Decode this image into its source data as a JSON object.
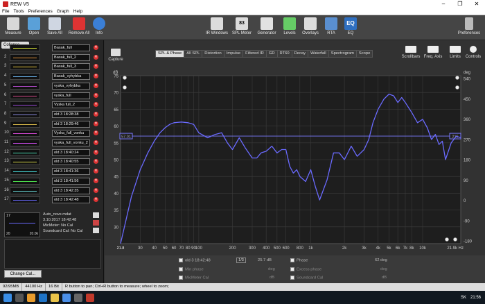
{
  "app": {
    "title": "REW V5",
    "window_controls": [
      "–",
      "❐",
      "✕"
    ]
  },
  "menu": [
    "File",
    "Tools",
    "Preferences",
    "Graph",
    "Help"
  ],
  "toolbar": {
    "left": [
      {
        "label": "Measure",
        "icon": "microphone-icon",
        "color": "#d8d8d8"
      },
      {
        "label": "Open",
        "icon": "folder-icon",
        "color": "#5aa0d8"
      },
      {
        "label": "Save All",
        "icon": "floppy-icon",
        "color": "#cfd6e2"
      },
      {
        "label": "Remove All",
        "icon": "remove-x-icon",
        "color": "#d33"
      },
      {
        "label": "Info",
        "icon": "info-icon",
        "color": "#3b7fd6"
      }
    ],
    "center": [
      {
        "label": "IR Windows",
        "icon": "ir-windows-icon",
        "color": "#dcdcdc"
      },
      {
        "label": "SPL Meter",
        "icon": "spl-meter-icon",
        "color": "#dcdcdc",
        "text": "SPL\n83"
      },
      {
        "label": "Generator",
        "icon": "generator-icon",
        "color": "#e2e2e2"
      },
      {
        "label": "Levels",
        "icon": "levels-icon",
        "color": "#6c6"
      },
      {
        "label": "Overlays",
        "icon": "overlays-icon",
        "color": "#dcdcdc"
      },
      {
        "label": "RTA",
        "icon": "rta-icon",
        "color": "#5a8fd0"
      },
      {
        "label": "EQ",
        "icon": "eq-icon",
        "color": "#2f6fc0",
        "text": "EQ"
      }
    ],
    "right": {
      "label": "Preferences",
      "icon": "wrench-icon"
    }
  },
  "left_panel": {
    "collapse": "Collapse",
    "measurements": [
      {
        "num": "1",
        "name": "Basak_full",
        "color": "#d9e63a"
      },
      {
        "num": "2",
        "name": "Basak_full_2",
        "color": "#e0903a"
      },
      {
        "num": "3",
        "name": "Basak_full_3",
        "color": "#e2c23a"
      },
      {
        "num": "4",
        "name": "Basak_vyhybka",
        "color": "#6ab0e8"
      },
      {
        "num": "5",
        "name": "vyska_vyhybka",
        "color": "#b04ac8"
      },
      {
        "num": "6",
        "name": "vyska_full",
        "color": "#d84a8a"
      },
      {
        "num": "7",
        "name": "Vyska full_2",
        "color": "#9a4ad8"
      },
      {
        "num": "8",
        "name": "old 3 18:28:38",
        "color": "#8a8ae0"
      },
      {
        "num": "9",
        "name": "old 3 18:29:46",
        "color": "#d8b84a"
      },
      {
        "num": "10",
        "name": "Vyska_full_vonku",
        "color": "#d84ad8"
      },
      {
        "num": "11",
        "name": "vyska_full_vonku_2",
        "color": "#c84ae8"
      },
      {
        "num": "12",
        "name": "old 3 18:40:24",
        "color": "#4ad8b0"
      },
      {
        "num": "13",
        "name": "old 3 18:40:55",
        "color": "#d8d84a"
      },
      {
        "num": "14",
        "name": "old 3 18:41:36",
        "color": "#4ae8e8"
      },
      {
        "num": "15",
        "name": "old 3 18:41:56",
        "color": "#4ad84a"
      },
      {
        "num": "16",
        "name": "old 3 18:42:35",
        "color": "#6ad8d8"
      },
      {
        "num": "17",
        "name": "old 3 18:42:48",
        "color": "#6a6aff"
      }
    ],
    "info": {
      "thumb_num": "17",
      "file": "Auto_nove.mdat",
      "date": "3.10.2017 18:42:48",
      "mic": "MicMeter: No Cal",
      "sound": "Soundcard Cal: No Cal",
      "range_left": "20",
      "range_right": "20.0k"
    },
    "change_cal": "Change Cal..."
  },
  "right_panel": {
    "capture": "Capture",
    "tabs": [
      "SPL & Phase",
      "All SPL",
      "Distortion",
      "Impulse",
      "Filtered IR",
      "GD",
      "RT60",
      "Decay",
      "Waterfall",
      "Spectrogram",
      "Scope"
    ],
    "active_tab": "SPL & Phase",
    "tools": [
      {
        "label": "Scrollbars",
        "icon": "scrollbars-icon"
      },
      {
        "label": "Freq. Axis",
        "icon": "freq-axis-icon"
      },
      {
        "label": "Limits",
        "icon": "limits-icon"
      },
      {
        "label": "Controls",
        "icon": "gear-icon"
      }
    ]
  },
  "chart_data": {
    "type": "line",
    "left_unit": "dB",
    "right_unit": "deg",
    "ylim": [
      25,
      75
    ],
    "y_ticks": [
      75,
      70,
      65,
      60,
      55,
      50,
      45,
      40,
      35,
      30
    ],
    "right_ticks": [
      "540",
      "450",
      "360",
      "270",
      "180",
      "90",
      "0",
      "-90",
      "-180"
    ],
    "x_scale": "log",
    "xlim": [
      20,
      21900
    ],
    "x_ticks": [
      {
        "v": 30,
        "l": "30"
      },
      {
        "v": 40,
        "l": "40"
      },
      {
        "v": 50,
        "l": "50"
      },
      {
        "v": 60,
        "l": "60"
      },
      {
        "v": 70,
        "l": "70"
      },
      {
        "v": 80,
        "l": "80"
      },
      {
        "v": 90,
        "l": "90"
      },
      {
        "v": 100,
        "l": "100"
      },
      {
        "v": 200,
        "l": "200"
      },
      {
        "v": 300,
        "l": "300"
      },
      {
        "v": 400,
        "l": "400"
      },
      {
        "v": 500,
        "l": "500"
      },
      {
        "v": 600,
        "l": "600"
      },
      {
        "v": 800,
        "l": "800"
      },
      {
        "v": 1000,
        "l": "1k"
      },
      {
        "v": 2000,
        "l": "2k"
      },
      {
        "v": 3000,
        "l": "3k"
      },
      {
        "v": 4000,
        "l": "4k"
      },
      {
        "v": 5000,
        "l": "5k"
      },
      {
        "v": 6000,
        "l": "6k"
      },
      {
        "v": 7000,
        "l": "7k"
      },
      {
        "v": 8000,
        "l": "8k"
      },
      {
        "v": 10000,
        "l": "10k"
      }
    ],
    "x_start_label": "21.8",
    "x_end_label": "21.9k Hz",
    "cursor_db": 57.01,
    "cursor_db_label": "57.01",
    "cursor_deg_label": "216",
    "series": [
      {
        "name": "old 3 18:42:48",
        "color": "#6a6aff",
        "x": [
          20,
          25,
          30,
          35,
          40,
          45,
          50,
          55,
          60,
          70,
          80,
          90,
          100,
          120,
          140,
          160,
          180,
          200,
          230,
          260,
          300,
          330,
          360,
          400,
          450,
          500,
          550,
          600,
          650,
          700,
          750,
          800,
          900,
          1000,
          1100,
          1200,
          1400,
          1600,
          1800,
          2000,
          2300,
          2600,
          3000,
          3300,
          3600,
          4000,
          4500,
          5000,
          5500,
          6000,
          6500,
          7000,
          8000,
          9000,
          10000,
          11000,
          12000,
          13000,
          14000,
          15000,
          16000,
          18000,
          20000,
          21900
        ],
        "y": [
          25,
          39,
          47,
          52,
          55.5,
          58,
          59.5,
          60.5,
          61,
          61.2,
          61,
          60.5,
          58,
          56.5,
          57.5,
          58,
          55,
          53,
          56.5,
          53.5,
          50.5,
          50.5,
          52,
          52.5,
          54,
          52,
          53,
          53,
          48,
          46,
          47,
          45,
          43.5,
          47,
          42,
          38,
          44,
          52,
          52,
          50,
          54,
          51,
          53,
          56,
          61,
          65,
          68,
          69.5,
          69,
          67,
          68.5,
          67,
          64,
          61,
          62,
          59.5,
          56,
          57.5,
          54.5,
          55.5,
          50,
          55,
          57,
          56.5
        ]
      }
    ]
  },
  "bottom_panel": {
    "rows": [
      {
        "on": true,
        "label": "old 3 18:42:48",
        "value": "",
        "unit": ""
      },
      {
        "on": true,
        "label": "Phase",
        "value": "62 deg",
        "unit": ""
      },
      {
        "on": false,
        "label": "Min phase",
        "value": "",
        "unit": "deg"
      },
      {
        "on": false,
        "label": "Excess phase",
        "value": "",
        "unit": "deg"
      },
      {
        "on": false,
        "label": "MicMeter Cal",
        "value": "",
        "unit": "dB"
      },
      {
        "on": false,
        "label": "Soundcard Cal",
        "value": "",
        "unit": "dB"
      }
    ],
    "spl_value": "25.7 dB",
    "vs_label": "1/3"
  },
  "status": {
    "memory": "92/95MB",
    "rate": "44100 Hz",
    "bits": "16 Bit",
    "hint": "R button to pan; Ctrl+R button to measure; wheel to zoom;"
  },
  "taskbar": {
    "time": "21:56",
    "lang": "SK"
  }
}
